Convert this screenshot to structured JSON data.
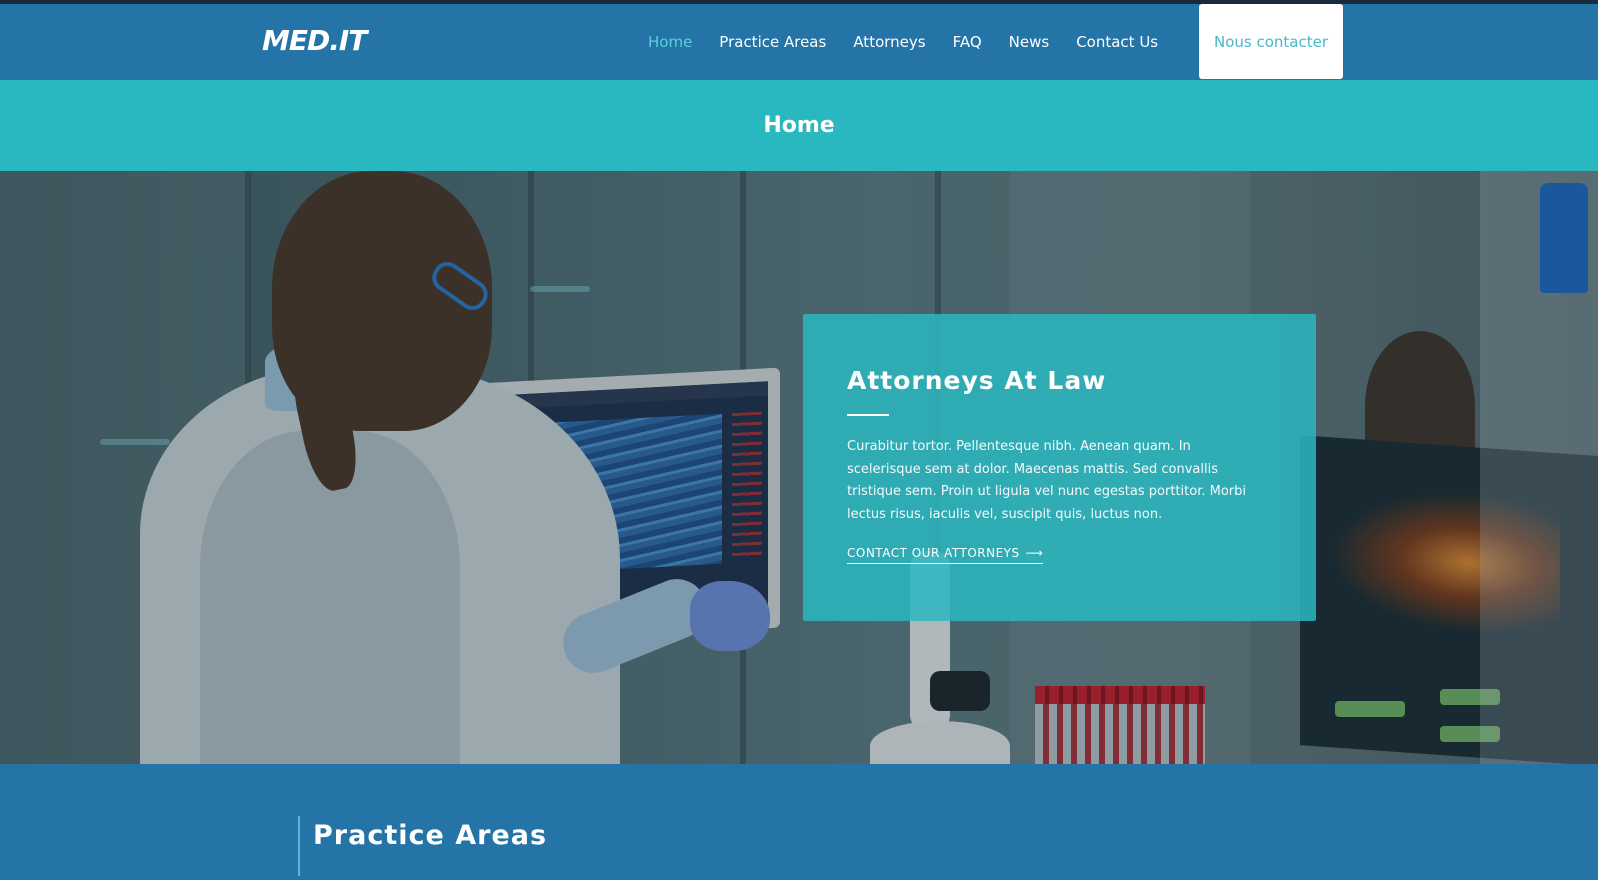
{
  "brand": {
    "logo": "MED.IT"
  },
  "nav": {
    "items": [
      {
        "label": "Home",
        "active": true
      },
      {
        "label": "Practice Areas",
        "active": false
      },
      {
        "label": "Attorneys",
        "active": false
      },
      {
        "label": "FAQ",
        "active": false
      },
      {
        "label": "News",
        "active": false
      },
      {
        "label": "Contact Us",
        "active": false
      }
    ],
    "cta_label": "Nous contacter"
  },
  "page": {
    "title": "Home"
  },
  "hero": {
    "card_title": "Attorneys At Law",
    "card_text": "Curabitur tortor. Pellentesque nibh. Aenean quam. In scelerisque sem at dolor. Maecenas mattis. Sed convallis tristique sem. Proin ut ligula vel nunc egestas porttitor. Morbi lectus risus, iaculis vel, suscipit quis, luctus non.",
    "card_link": "CONTACT OUR ATTORNEYS",
    "link_icon": "arrow-right-icon"
  },
  "section": {
    "title": "Practice Areas"
  },
  "colors": {
    "nav_bg": "#2474a8",
    "accent": "#29b7c0",
    "active_link": "#5ad0d8",
    "cta_text": "#49b8c8"
  }
}
